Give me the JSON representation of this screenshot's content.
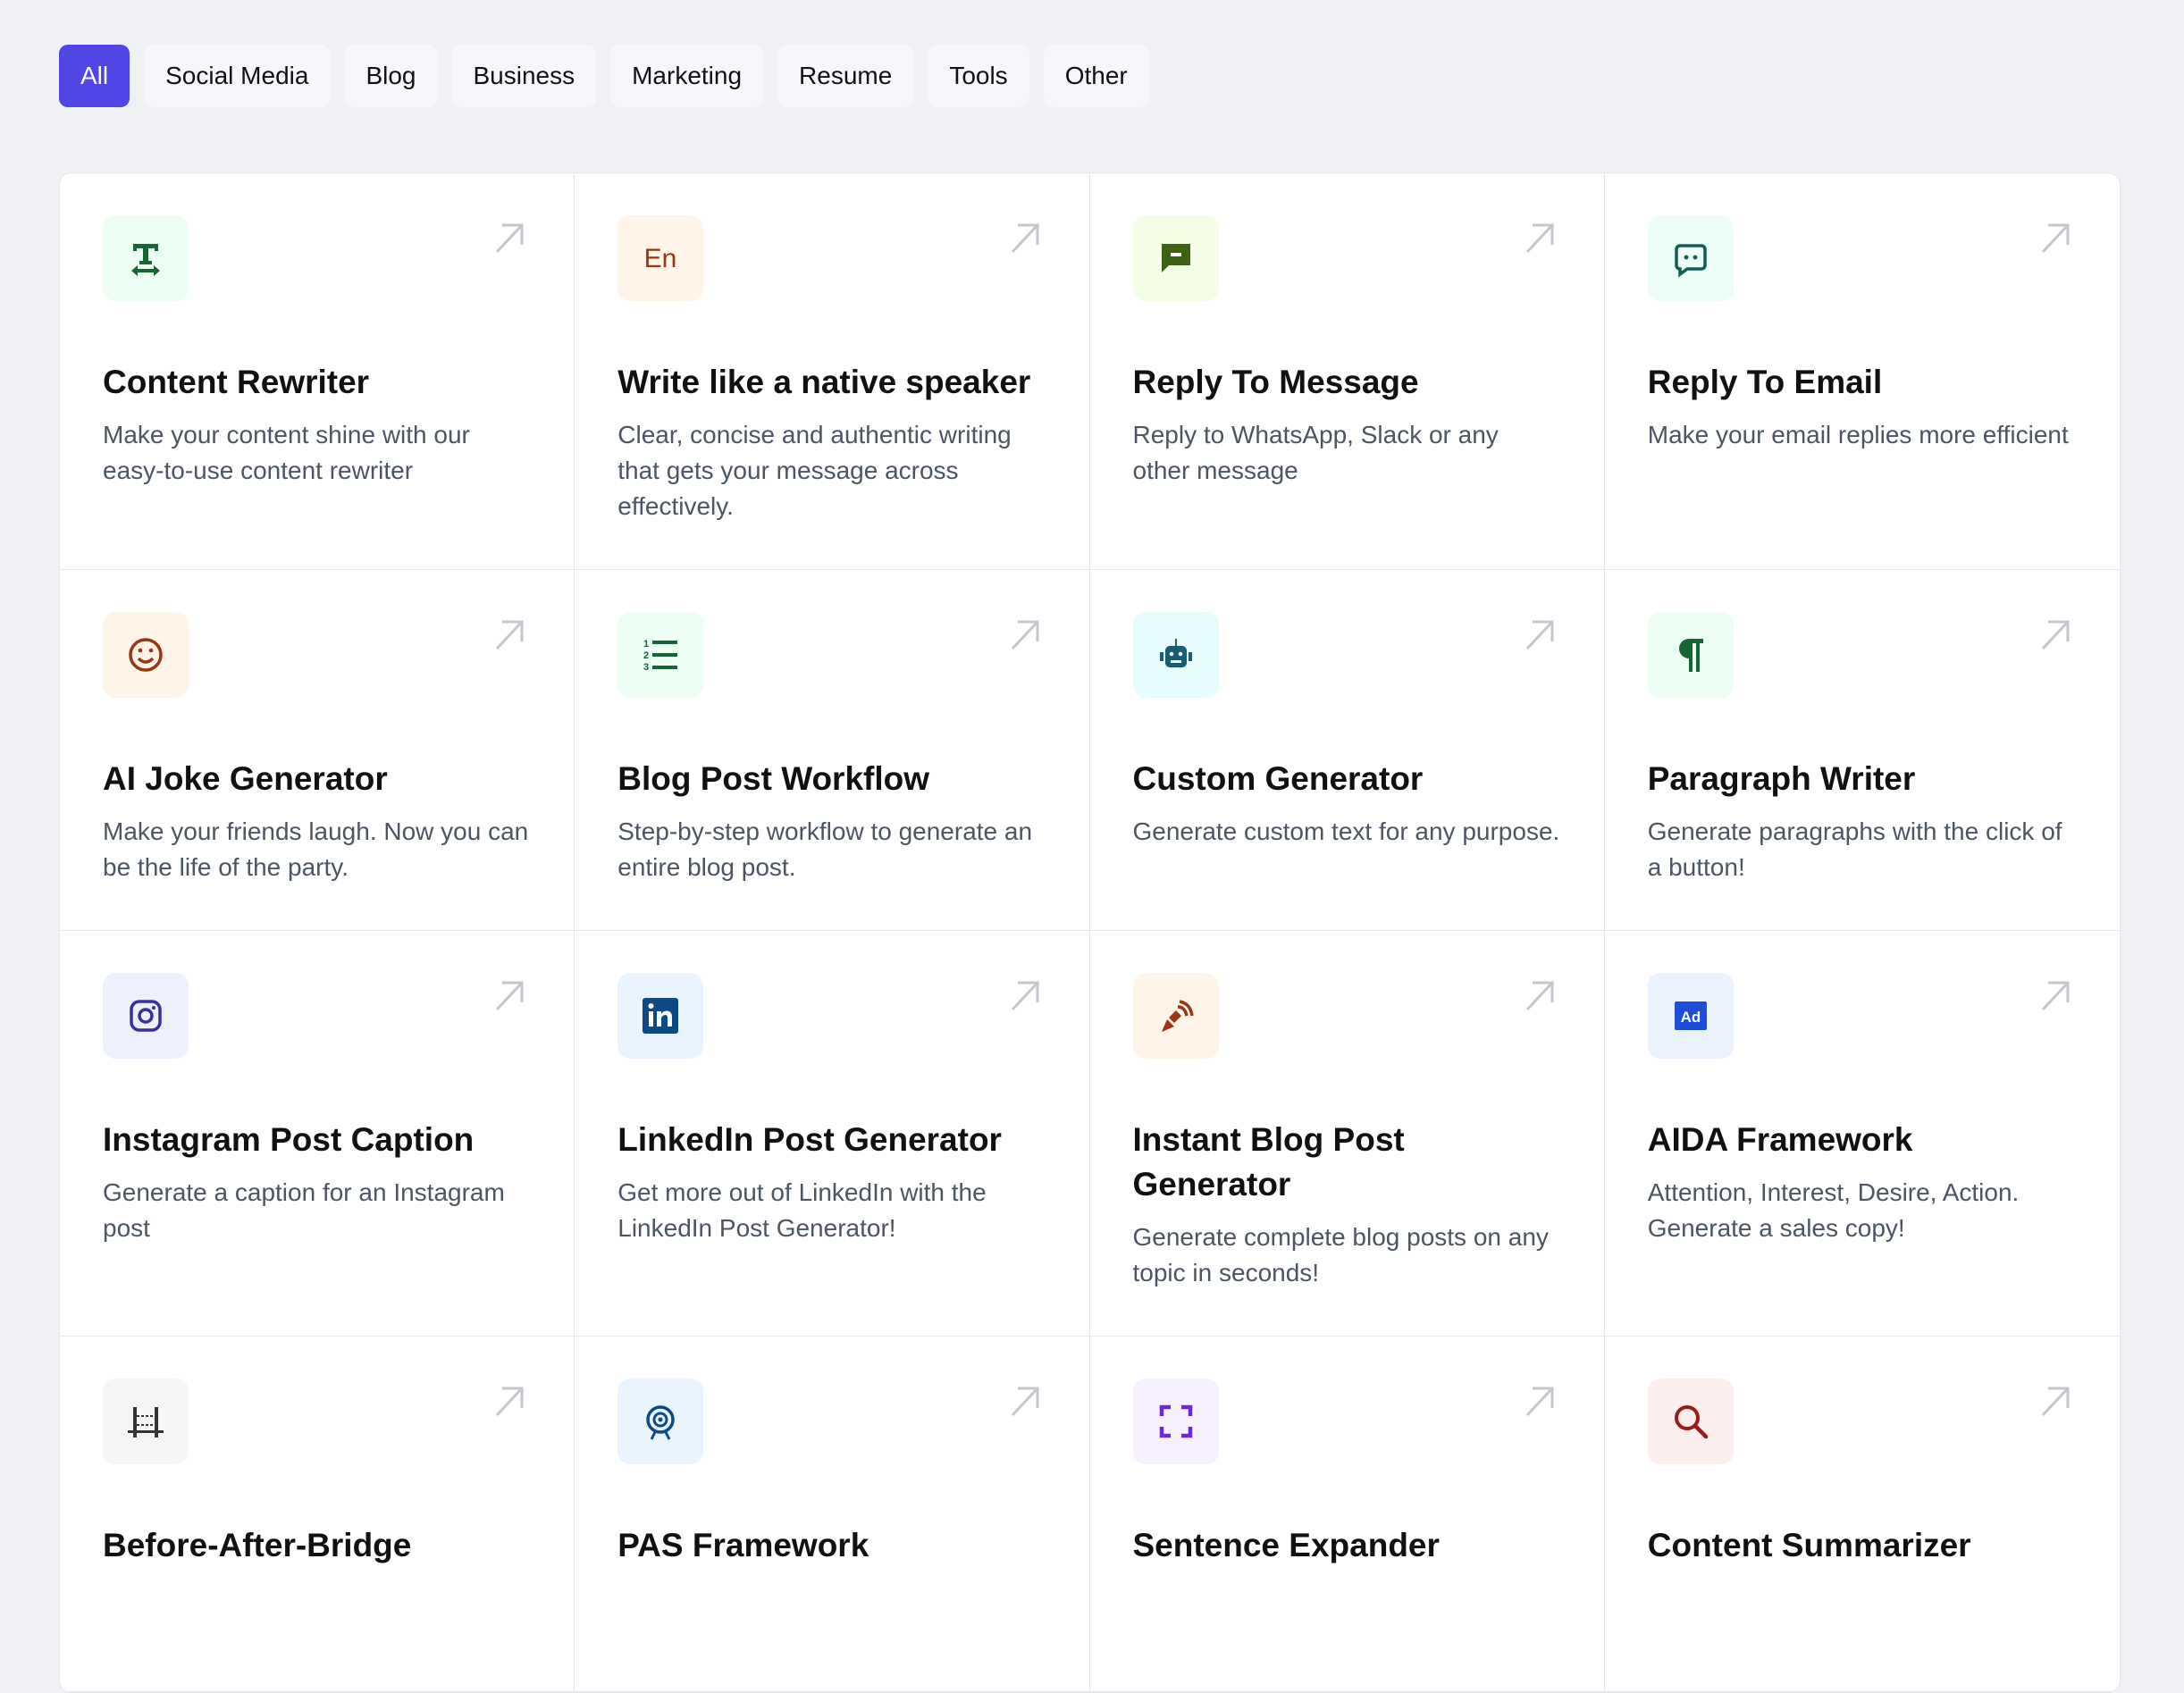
{
  "tabs": [
    {
      "label": "All",
      "active": true
    },
    {
      "label": "Social Media"
    },
    {
      "label": "Blog"
    },
    {
      "label": "Business"
    },
    {
      "label": "Marketing"
    },
    {
      "label": "Resume"
    },
    {
      "label": "Tools"
    },
    {
      "label": "Other"
    }
  ],
  "colors": {
    "accent": "#4f46e5"
  },
  "cards": [
    {
      "title": "Content Rewriter",
      "desc": "Make your content shine with our easy-to-use content rewriter",
      "icon": "text-width-icon",
      "bg": "#ecfdf3",
      "fg": "#166534"
    },
    {
      "title": "Write like a native speaker",
      "desc": "Clear, concise and authentic writing that gets your message across effectively.",
      "icon": "language-en-icon",
      "bg": "#fff4e8",
      "fg": "#9a3412"
    },
    {
      "title": "Reply To Message",
      "desc": "Reply to WhatsApp, Slack or any other message",
      "icon": "message-icon",
      "bg": "#f4fee6",
      "fg": "#3f6212"
    },
    {
      "title": "Reply To Email",
      "desc": "Make your email replies more efficient",
      "icon": "chat-bubble-icon",
      "bg": "#ecfdf5",
      "fg": "#115e59"
    },
    {
      "title": "AI Joke Generator",
      "desc": "Make your friends laugh. Now you can be the life of the party.",
      "icon": "smiley-icon",
      "bg": "#fff4e8",
      "fg": "#9a3412"
    },
    {
      "title": "Blog Post Workflow",
      "desc": "Step-by-step workflow to generate an entire blog post.",
      "icon": "numbered-list-icon",
      "bg": "#ecfdf3",
      "fg": "#166534"
    },
    {
      "title": "Custom Generator",
      "desc": "Generate custom text for any purpose.",
      "icon": "robot-icon",
      "bg": "#e6fcfd",
      "fg": "#155e75"
    },
    {
      "title": "Paragraph Writer",
      "desc": "Generate paragraphs with the click of a button!",
      "icon": "pilcrow-icon",
      "bg": "#ecfdf3",
      "fg": "#166534"
    },
    {
      "title": "Instagram Post Caption",
      "desc": "Generate a caption for an Instagram post",
      "icon": "instagram-icon",
      "bg": "#eef0fe",
      "fg": "#3730a3"
    },
    {
      "title": "LinkedIn Post Generator",
      "desc": "Get more out of LinkedIn with the LinkedIn Post Generator!",
      "icon": "linkedin-icon",
      "bg": "#eaf4fe",
      "fg": "#0c4a86"
    },
    {
      "title": "Instant Blog Post Generator",
      "desc": "Generate complete blog posts on any topic in seconds!",
      "icon": "pen-nib-icon",
      "bg": "#fff4e8",
      "fg": "#9a3412"
    },
    {
      "title": "AIDA Framework",
      "desc": "Attention, Interest, Desire, Action. Generate a sales copy!",
      "icon": "ad-icon",
      "bg": "#eaf2fe",
      "fg": "#1d4ed8"
    },
    {
      "title": "Before-After-Bridge",
      "desc": "",
      "icon": "bridge-icon",
      "bg": "#f6f6f7",
      "fg": "#333333"
    },
    {
      "title": "PAS Framework",
      "desc": "",
      "icon": "target-icon",
      "bg": "#eaf4fe",
      "fg": "#0c4a86"
    },
    {
      "title": "Sentence Expander",
      "desc": "",
      "icon": "expand-icon",
      "bg": "#f7f0fe",
      "fg": "#6d28d9"
    },
    {
      "title": "Content Summarizer",
      "desc": "",
      "icon": "search-icon",
      "bg": "#fdeeee",
      "fg": "#991b1b"
    }
  ]
}
